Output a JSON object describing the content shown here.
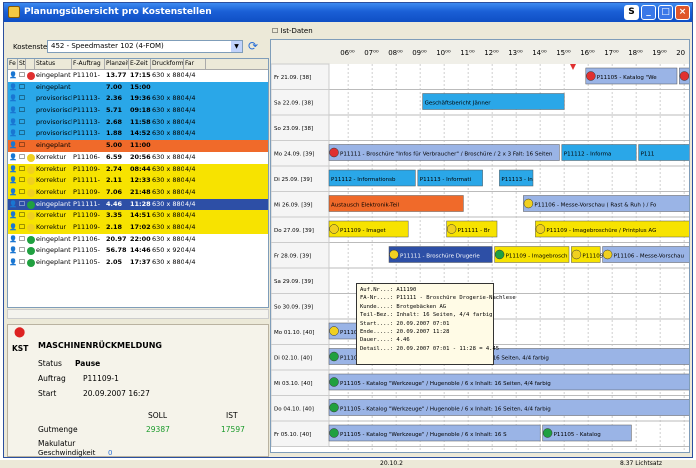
{
  "window": {
    "title": "Planungsübersicht pro Kostenstellen",
    "btn_s": "S"
  },
  "filter": {
    "label": "Kostenstelle",
    "value": "452 - Speedmaster 102 (4-FOM)"
  },
  "table": {
    "headers": [
      "Fe",
      "Status",
      "Status",
      "F-Auftrag",
      "Planzeit",
      "E-Zeit",
      "Druckformat",
      "Far"
    ],
    "rows": [
      {
        "status": "eingeplant",
        "job": "P11101-",
        "plan": "13.77",
        "ez": "17:15",
        "fmt": "630 x 880",
        "far": "4/4",
        "bg": "#ffffff",
        "dot": "#e03030"
      },
      {
        "status": "eingeplant",
        "job": "",
        "plan": "7.00",
        "ez": "15:00",
        "fmt": "",
        "far": "",
        "bg": "#2aa7e8",
        "dot": ""
      },
      {
        "status": "provisorisch",
        "job": "P11113-",
        "plan": "2.36",
        "ez": "19:36",
        "fmt": "630 x 880",
        "far": "4/4",
        "bg": "#2aa7e8",
        "dot": ""
      },
      {
        "status": "provisorisch",
        "job": "P11113-",
        "plan": "5.71",
        "ez": "09:18",
        "fmt": "630 x 880",
        "far": "4/4",
        "bg": "#2aa7e8",
        "dot": ""
      },
      {
        "status": "provisorisch",
        "job": "P11113-",
        "plan": "2.68",
        "ez": "11:58",
        "fmt": "630 x 880",
        "far": "4/4",
        "bg": "#2aa7e8",
        "dot": ""
      },
      {
        "status": "provisorisch",
        "job": "P11113-",
        "plan": "1.88",
        "ez": "14:52",
        "fmt": "630 x 880",
        "far": "4/4",
        "bg": "#2aa7e8",
        "dot": ""
      },
      {
        "status": "eingeplant",
        "job": "",
        "plan": "5.00",
        "ez": "11:00",
        "fmt": "",
        "far": "",
        "bg": "#f06a2a",
        "dot": ""
      },
      {
        "status": "Korrektur",
        "job": "P11106-",
        "plan": "6.59",
        "ez": "20:56",
        "fmt": "630 x 880",
        "far": "4/4",
        "bg": "#ffffff",
        "dot": "#f0d020"
      },
      {
        "status": "Korrektur",
        "job": "P11109-",
        "plan": "2.74",
        "ez": "08:44",
        "fmt": "630 x 880",
        "far": "4/4",
        "bg": "#f7e300",
        "dot": "#f0d020"
      },
      {
        "status": "Korrektur",
        "job": "P11111-",
        "plan": "2.11",
        "ez": "12:33",
        "fmt": "630 x 880",
        "far": "4/4",
        "bg": "#f7e300",
        "dot": "#f0d020"
      },
      {
        "status": "Korrektur",
        "job": "P11109-",
        "plan": "7.06",
        "ez": "21:48",
        "fmt": "630 x 880",
        "far": "4/4",
        "bg": "#f7e300",
        "dot": "#f0d020"
      },
      {
        "status": "eingeplant",
        "job": "P11111-",
        "plan": "4.46",
        "ez": "11:28",
        "fmt": "630 x 880",
        "far": "4/4",
        "bg": "#2d4fa6",
        "dot": "#20a040"
      },
      {
        "status": "Korrektur",
        "job": "P11109-",
        "plan": "3.35",
        "ez": "14:51",
        "fmt": "630 x 880",
        "far": "4/4",
        "bg": "#f7e300",
        "dot": "#f0d020"
      },
      {
        "status": "Korrektur",
        "job": "P11109-",
        "plan": "2.18",
        "ez": "17:02",
        "fmt": "630 x 880",
        "far": "4/4",
        "bg": "#f7e300",
        "dot": "#f0d020"
      },
      {
        "status": "eingeplant",
        "job": "P11106-",
        "plan": "20.97",
        "ez": "22:00",
        "fmt": "630 x 880",
        "far": "4/4",
        "bg": "#ffffff",
        "dot": "#20a040"
      },
      {
        "status": "eingeplant",
        "job": "P11105-",
        "plan": "56.78",
        "ez": "14:46",
        "fmt": "650 x 920",
        "far": "4/4",
        "bg": "#ffffff",
        "dot": "#20a040"
      },
      {
        "status": "eingeplant",
        "job": "P11105-",
        "plan": "2.05",
        "ez": "17:37",
        "fmt": "630 x 880",
        "far": "4/4",
        "bg": "#ffffff",
        "dot": "#20a040"
      }
    ]
  },
  "machine": {
    "title": "MASCHINENRÜCKMELDUNG",
    "tab": "KST",
    "status_label": "Status",
    "status_value": "Pause",
    "order_label": "Auftrag",
    "order_value": "P11109-1",
    "start_label": "Start",
    "start_value": "20.09.2007 16:27",
    "col_soll": "SOLL",
    "col_ist": "IST",
    "good_label": "Gutmenge",
    "good_soll": "29387",
    "good_ist": "17597",
    "waste_label": "Makulatur",
    "speed_label": "Geschwindigkeit",
    "speed_value": "0"
  },
  "gantt": {
    "ist_label": "Ist-Daten",
    "hours": [
      "06⁰⁰",
      "07⁰⁰",
      "08⁰⁰",
      "09⁰⁰",
      "10⁰⁰",
      "11⁰⁰",
      "12⁰⁰",
      "13⁰⁰",
      "14⁰⁰",
      "15⁰⁰",
      "16⁰⁰",
      "17⁰⁰",
      "18⁰⁰",
      "19⁰⁰",
      "20"
    ],
    "days": [
      "Fr 21.09. [38]",
      "Sa 22.09. [38]",
      "So 23.09. [38]",
      "Mo 24.09. [39]",
      "Di 25.09. [39]",
      "Mi 26.09. [39]",
      "Do 27.09. [39]",
      "Fr 28.09. [39]",
      "Sa 29.09. [39]",
      "So 30.09. [39]",
      "Mo 01.10. [40]",
      "Di 02.10. [40]",
      "Mi 03.10. [40]",
      "Do 04.10. [40]",
      "Fr 05.10. [40]"
    ],
    "bars": [
      {
        "row": 0,
        "s": 15.9,
        "e": 19.7,
        "color": "#9ab4e6",
        "text": "P11105 - Katalog \"We",
        "dot": "#e03030"
      },
      {
        "row": 0,
        "s": 19.8,
        "e": 20.6,
        "color": "#9ab4e6",
        "text": "P1",
        "dot": "#e03030"
      },
      {
        "row": 1,
        "s": 9.1,
        "e": 15.0,
        "color": "#2aa7e8",
        "text": "Geschäftsbericht Jänner",
        "dot": ""
      },
      {
        "row": 3,
        "s": 5.2,
        "e": 14.8,
        "color": "#9ab4e6",
        "text": "P11111 - Broschüre \"Infos für Verbraucher\" / Broschüre / 2 x 3 Falt: 16 Seiten",
        "dot": "#e03030"
      },
      {
        "row": 3,
        "s": 14.9,
        "e": 18.0,
        "color": "#2aa7e8",
        "text": "P11112 - Informa",
        "dot": ""
      },
      {
        "row": 3,
        "s": 18.1,
        "e": 20.6,
        "color": "#2aa7e8",
        "text": "P111",
        "dot": ""
      },
      {
        "row": 4,
        "s": 5.2,
        "e": 8.8,
        "color": "#2aa7e8",
        "text": "P11112 - Informationsb",
        "dot": ""
      },
      {
        "row": 4,
        "s": 8.9,
        "e": 11.6,
        "color": "#2aa7e8",
        "text": "P11113 - Informati",
        "dot": ""
      },
      {
        "row": 4,
        "s": 12.3,
        "e": 13.7,
        "color": "#2aa7e8",
        "text": "P11113 - In",
        "dot": ""
      },
      {
        "row": 5,
        "s": 5.2,
        "e": 10.8,
        "color": "#f06a2a",
        "text": "Austausch Elektronik-Teil",
        "dot": ""
      },
      {
        "row": 5,
        "s": 13.3,
        "e": 20.6,
        "color": "#9ab4e6",
        "text": "P11106 - Messe-Vorschau ( Rast & Ruh ) / Fo",
        "dot": "#f0d020"
      },
      {
        "row": 6,
        "s": 5.2,
        "e": 8.5,
        "color": "#f7e300",
        "text": "P11109 - Imaget",
        "dot": "#f0d020"
      },
      {
        "row": 6,
        "s": 10.1,
        "e": 12.2,
        "color": "#f7e300",
        "text": "P11111 - Br",
        "dot": "#f0d020"
      },
      {
        "row": 6,
        "s": 13.8,
        "e": 20.6,
        "color": "#f7e300",
        "text": "P11109 - Imagebroschüre / Printplus AG",
        "dot": "#f0d020"
      },
      {
        "row": 7,
        "s": 7.7,
        "e": 12.0,
        "color": "#2d4fa6",
        "text": "P11111 - Broschüre Drugerie",
        "dot": "#f0d020"
      },
      {
        "row": 7,
        "s": 12.1,
        "e": 15.2,
        "color": "#f7e300",
        "text": "P11109 - Imagebrosch",
        "dot": "#20a040"
      },
      {
        "row": 7,
        "s": 15.3,
        "e": 16.5,
        "color": "#f7e300",
        "text": "P11109 - Im",
        "dot": "#f0d020"
      },
      {
        "row": 7,
        "s": 16.6,
        "e": 20.6,
        "color": "#9ab4e6",
        "text": "P11106 - Messe-Vorschau",
        "dot": "#f0d020"
      },
      {
        "row": 10,
        "s": 5.2,
        "e": 9.0,
        "color": "#9ab4e6",
        "text": "P11106 - M",
        "dot": "#f0d020"
      },
      {
        "row": 11,
        "s": 5.2,
        "e": 20.6,
        "color": "#9ab4e6",
        "text": "P11105 - Katalog \"Werkzeuge\" / Hugenoble / 6 x Inhalt 16 Seiten, 4/4 farbig",
        "dot": "#20a040"
      },
      {
        "row": 12,
        "s": 5.2,
        "e": 20.6,
        "color": "#9ab4e6",
        "text": "P11105 - Katalog \"Werkzeuge\" / Hugenoble / 6 x Inhalt: 16 Seiten, 4/4 farbig",
        "dot": "#20a040"
      },
      {
        "row": 13,
        "s": 5.2,
        "e": 20.6,
        "color": "#9ab4e6",
        "text": "P11105 - Katalog \"Werkzeuge\" / Hugenoble / 6 x Inhalt: 16 Seiten, 4/4 farbig",
        "dot": "#20a040"
      },
      {
        "row": 14,
        "s": 5.2,
        "e": 14.0,
        "color": "#9ab4e6",
        "text": "P11105 - Katalog \"Werkzeuge\" / Hugenoble / 6 x Inhalt: 16 S",
        "dot": "#20a040"
      },
      {
        "row": 14,
        "s": 14.1,
        "e": 17.8,
        "color": "#9ab4e6",
        "text": "P11105 - Katalog",
        "dot": "#20a040"
      }
    ],
    "tooltip": "Auf.Nr...: A11190\nFA-Nr....: P11111 - Broschüre Drogerie-Nachlese\nKunde....: Brotgebäcken AG\nTeil-Bez.: Inhalt: 16 Seiten, 4/4 farbig\nStart....: 20.09.2007 07:01\nEnde.....: 20.09.2007 11:28\nDauer....: 4.46\nDetail...: 20.09.2007 07:01 - 11:28 = 4.45"
  },
  "status": {
    "mid": "20.10.2",
    "right": "8.37 Lichtsatz"
  },
  "colors": {
    "accent": "#2a6fd6",
    "title_bar": "#1a5fd6"
  }
}
